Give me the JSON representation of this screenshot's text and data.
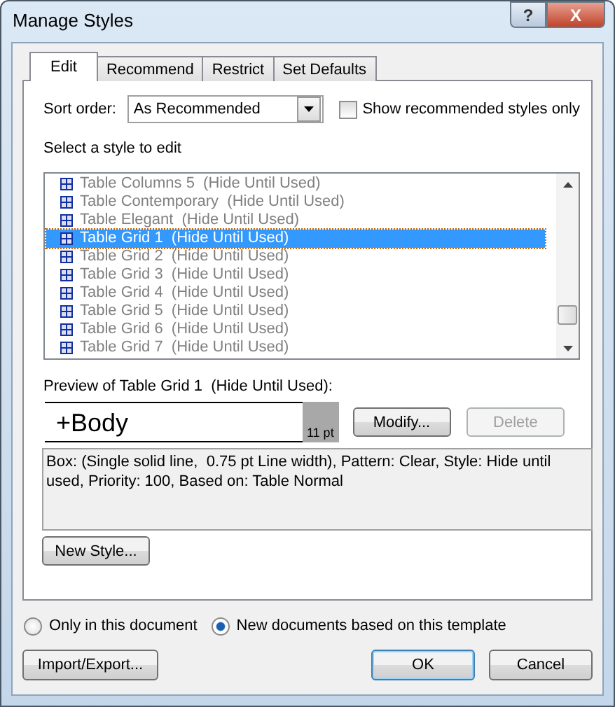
{
  "window": {
    "title": "Manage Styles",
    "controls": [
      "?",
      "X"
    ]
  },
  "tabs": [
    {
      "label": "Edit",
      "selected": true
    },
    {
      "label": "Recommend",
      "selected": false
    },
    {
      "label": "Restrict",
      "selected": false
    },
    {
      "label": "Set Defaults",
      "selected": false
    }
  ],
  "sort_order": {
    "label": "Sort order:",
    "value": "As Recommended"
  },
  "show_recommended": {
    "label": "Show recommended styles only",
    "checked": false
  },
  "list_label": "Select a style to edit",
  "styles": [
    {
      "name": "Table Columns 5  (Hide Until Used)",
      "selected": false
    },
    {
      "name": "Table Contemporary  (Hide Until Used)",
      "selected": false
    },
    {
      "name": "Table Elegant  (Hide Until Used)",
      "selected": false
    },
    {
      "name": "Table Grid 1  (Hide Until Used)",
      "selected": true
    },
    {
      "name": "Table Grid 2  (Hide Until Used)",
      "selected": false
    },
    {
      "name": "Table Grid 3  (Hide Until Used)",
      "selected": false
    },
    {
      "name": "Table Grid 4  (Hide Until Used)",
      "selected": false
    },
    {
      "name": "Table Grid 5  (Hide Until Used)",
      "selected": false
    },
    {
      "name": "Table Grid 6  (Hide Until Used)",
      "selected": false
    },
    {
      "name": "Table Grid 7  (Hide Until Used)",
      "selected": false
    }
  ],
  "preview": {
    "label": "Preview of Table Grid 1  (Hide Until Used):",
    "font": "+Body",
    "size": "11 pt"
  },
  "preview_buttons": [
    {
      "label": "Modify...",
      "disabled": false
    },
    {
      "label": "Delete",
      "disabled": true
    }
  ],
  "description": "Box: (Single solid line,  0.75 pt Line width), Pattern: Clear, Style: Hide until used, Priority: 100, Based on: Table Normal",
  "new_style_button": "New Style...",
  "scope": [
    {
      "label": "Only in this document",
      "selected": false
    },
    {
      "label": "New documents based on this template",
      "selected": true
    }
  ],
  "footer_buttons": [
    {
      "kind": "left",
      "label": "Import/Export..."
    },
    {
      "kind": "default",
      "label": "OK"
    },
    {
      "kind": "plain",
      "label": "Cancel"
    }
  ]
}
